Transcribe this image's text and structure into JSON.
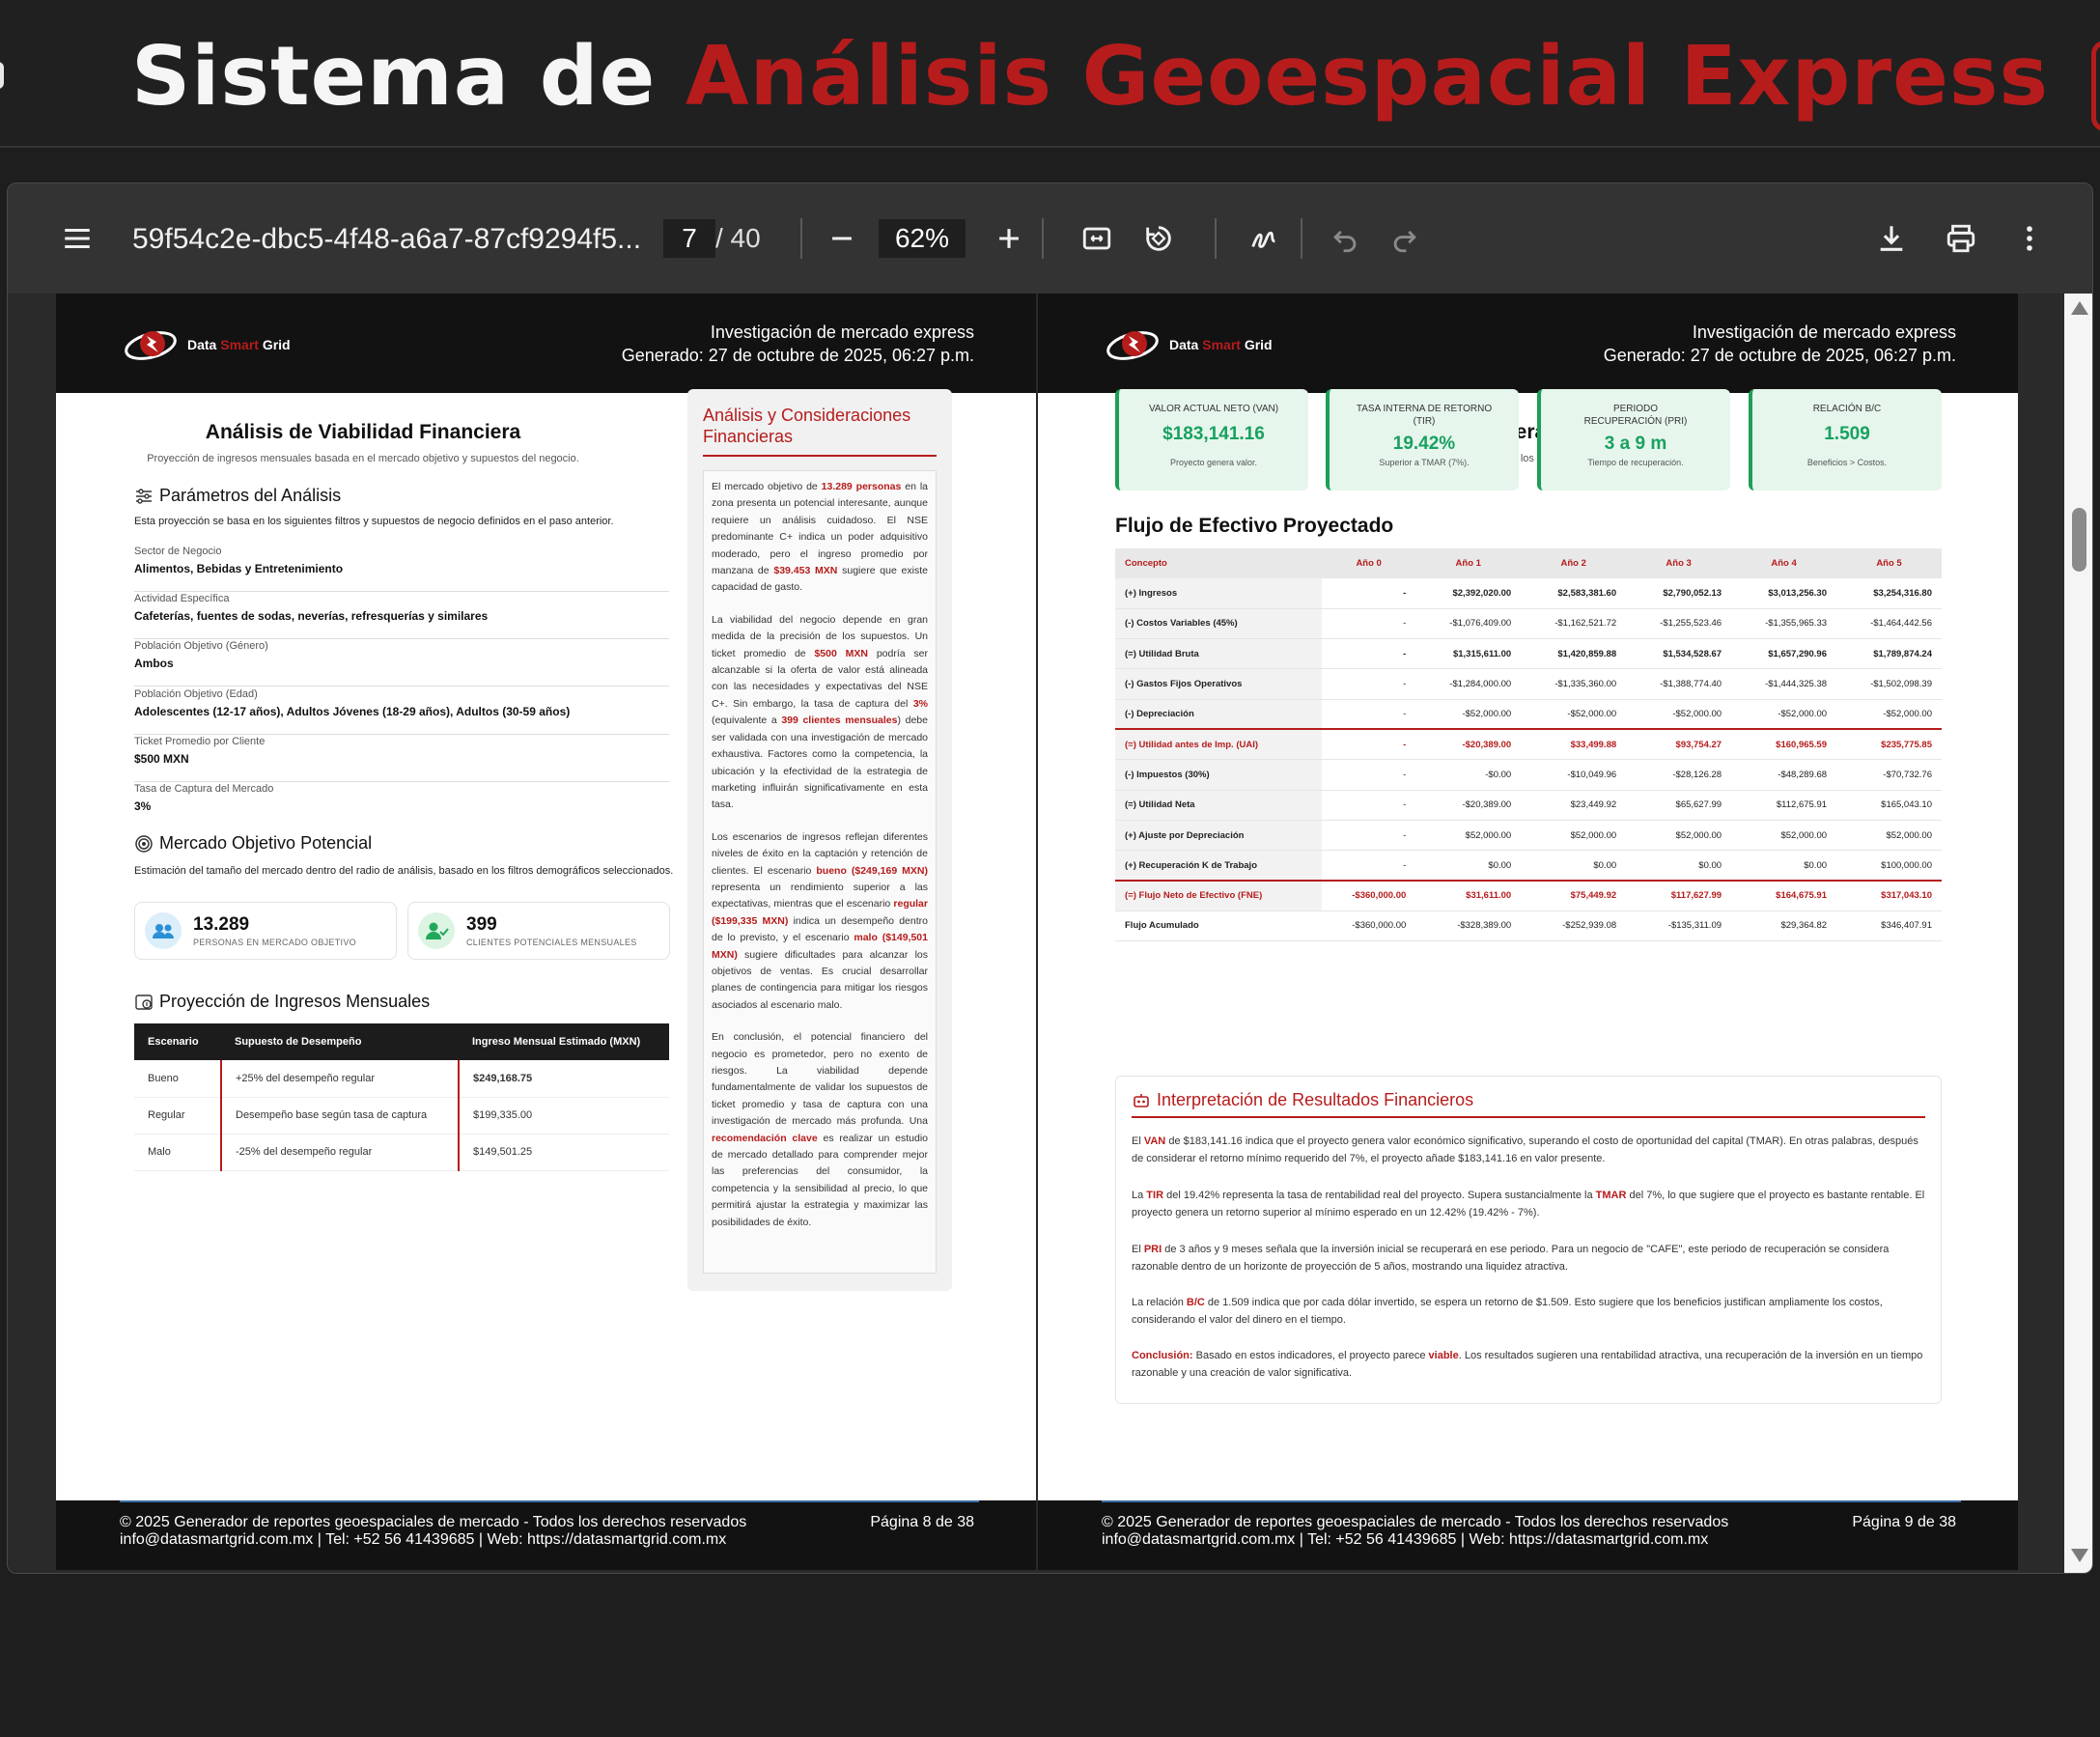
{
  "app": {
    "title_part1": "Sistema de",
    "title_part2": "Análisis Geoespacial Express"
  },
  "toolbar": {
    "doc_name": "59f54c2e-dbc5-4f48-a6a7-87cf9294f5...",
    "current_page": "7",
    "total_pages": "/ 40",
    "zoom": "62%",
    "icons": [
      "menu-icon",
      "zoom-out-icon",
      "zoom-in-icon",
      "fit-page-icon",
      "rotate-icon",
      "draw-icon",
      "undo-icon",
      "redo-icon",
      "download-icon",
      "print-icon",
      "more-icon"
    ]
  },
  "brand": {
    "part1": "Data",
    "part2": "Smart",
    "part3": "Grid",
    "accent": "#b61c1c"
  },
  "header": {
    "line1": "Investigación de mercado express",
    "line2": "Generado: 27 de octubre de 2025, 06:27 p.m."
  },
  "footer": {
    "line1": "© 2025 Generador de reportes geoespaciales de mercado - Todos los derechos reservados",
    "line2": "info@datasmartgrid.com.mx | Tel: +52 56 41439685 | Web: https://datasmartgrid.com.mx",
    "page_left": "Página 8 de 38",
    "page_right": "Página 9 de 38"
  },
  "left": {
    "title": "Análisis de Viabilidad Financiera",
    "subtitle": "Proyección de ingresos mensuales basada en el mercado objetivo y supuestos del negocio.",
    "params_title": "Parámetros del Análisis",
    "params_desc": "Esta proyección se basa en los siguientes filtros y supuestos de negocio definidos en el paso anterior.",
    "params": [
      {
        "k": "Sector de Negocio",
        "v": "Alimentos, Bebidas y Entretenimiento"
      },
      {
        "k": "Actividad Específica",
        "v": "Cafeterías, fuentes de sodas, neverías, refresquerías y similares"
      },
      {
        "k": "Población Objetivo (Género)",
        "v": "Ambos"
      },
      {
        "k": "Población Objetivo (Edad)",
        "v": "Adolescentes (12-17 años), Adultos Jóvenes (18-29 años), Adultos (30-59 años)"
      },
      {
        "k": "Ticket Promedio por Cliente",
        "v": "$500 MXN"
      },
      {
        "k": "Tasa de Captura del Mercado",
        "v": "3%"
      }
    ],
    "market_title": "Mercado Objetivo Potencial",
    "market_desc": "Estimación del tamaño del mercado dentro del radio de análisis, basado en los filtros demográficos seleccionados.",
    "stat1": {
      "num": "13.289",
      "label": "PERSONAS EN MERCADO OBJETIVO"
    },
    "stat2": {
      "num": "399",
      "label": "CLIENTES POTENCIALES MENSUALES"
    },
    "proj_title": "Proyección de Ingresos Mensuales",
    "proj_headers": [
      "Escenario",
      "Supuesto de Desempeño",
      "Ingreso Mensual Estimado (MXN)"
    ],
    "proj_rows": [
      [
        "Bueno",
        "+25% del desempeño regular",
        "$249,168.75"
      ],
      [
        "Regular",
        "Desempeño base según tasa de captura",
        "$199,335.00"
      ],
      [
        "Malo",
        "-25% del desempeño regular",
        "$149,501.25"
      ]
    ],
    "side_title": "Análisis y Consideraciones Financieras",
    "side_p1": [
      "El mercado objetivo de ",
      "13.289 personas",
      " en la zona presenta un potencial interesante, aunque requiere un análisis cuidadoso. El NSE predominante C+ indica un poder adquisitivo moderado, pero el ingreso promedio por manzana de ",
      "$39.453 MXN",
      " sugiere que existe capacidad de gasto."
    ],
    "side_p2": [
      "La viabilidad del negocio depende en gran medida de la precisión de los supuestos. Un ticket promedio de ",
      "$500 MXN",
      " podría ser alcanzable si la oferta de valor está alineada con las necesidades y expectativas del NSE C+. Sin embargo, la tasa de captura del ",
      "3%",
      " (equivalente a ",
      "399 clientes mensuales",
      ") debe ser validada con una investigación de mercado exhaustiva. Factores como la competencia, la ubicación y la efectividad de la estrategia de marketing influirán significativamente en esta tasa."
    ],
    "side_p3": [
      "Los escenarios de ingresos reflejan diferentes niveles de éxito en la captación y retención de clientes. El escenario ",
      "bueno ($249,169 MXN)",
      " representa un rendimiento superior a las expectativas, mientras que el escenario ",
      "regular ($199,335 MXN)",
      " indica un desempeño dentro de lo previsto, y el escenario ",
      "malo ($149,501 MXN)",
      " sugiere dificultades para alcanzar los objetivos de ventas. Es crucial desarrollar planes de contingencia para mitigar los riesgos asociados al escenario malo."
    ],
    "side_p4": [
      "En conclusión, el potencial financiero del negocio es prometedor, pero no exento de riesgos. La viabilidad depende fundamentalmente de validar los supuestos de ticket promedio y tasa de captura con una investigación de mercado más profunda. Una ",
      "recomendación clave",
      " es realizar un estudio de mercado detallado para comprender mejor las preferencias del consumidor, la competencia y la sensibilidad al precio, lo que permitirá ajustar la estrategia y maximizar las posibilidades de éxito."
    ]
  },
  "right": {
    "title": "Corrida Financiera Estandarizada",
    "subtitle": "Proyección basada en los supuestos ingresados.",
    "kpis": [
      {
        "t": "VALOR ACTUAL NETO (VAN)",
        "v": "$183,141.16",
        "n": "Proyecto genera valor."
      },
      {
        "t": "TASA INTERNA DE RETORNO (TIR)",
        "v": "19.42%",
        "n": "Superior a TMAR (7%)."
      },
      {
        "t": "PERIODO RECUPERACIÓN (PRI)",
        "v": "3 a 9 m",
        "n": "Tiempo de recuperación."
      },
      {
        "t": "RELACIÓN B/C",
        "v": "1.509",
        "n": "Beneficios > Costos."
      }
    ],
    "flow_title": "Flujo de Efectivo Proyectado",
    "flow_headers": [
      "Concepto",
      "Año 0",
      "Año 1",
      "Año 2",
      "Año 3",
      "Año 4",
      "Año 5"
    ],
    "flow_rows": [
      [
        "(+) Ingresos",
        "-",
        "$2,392,020.00",
        "$2,583,381.60",
        "$2,790,052.13",
        "$3,013,256.30",
        "$3,254,316.80"
      ],
      [
        "(-) Costos Variables (45%)",
        "-",
        "-$1,076,409.00",
        "-$1,162,521.72",
        "-$1,255,523.46",
        "-$1,355,965.33",
        "-$1,464,442.56"
      ],
      [
        "(=) Utilidad Bruta",
        "-",
        "$1,315,611.00",
        "$1,420,859.88",
        "$1,534,528.67",
        "$1,657,290.96",
        "$1,789,874.24"
      ],
      [
        "(-) Gastos Fijos Operativos",
        "-",
        "-$1,284,000.00",
        "-$1,335,360.00",
        "-$1,388,774.40",
        "-$1,444,325.38",
        "-$1,502,098.39"
      ],
      [
        "(-) Depreciación",
        "-",
        "-$52,000.00",
        "-$52,000.00",
        "-$52,000.00",
        "-$52,000.00",
        "-$52,000.00"
      ],
      [
        "(=) Utilidad antes de Imp. (UAI)",
        "-",
        "-$20,389.00",
        "$33,499.88",
        "$93,754.27",
        "$160,965.59",
        "$235,775.85"
      ],
      [
        "(-) Impuestos (30%)",
        "-",
        "-$0.00",
        "-$10,049.96",
        "-$28,126.28",
        "-$48,289.68",
        "-$70,732.76"
      ],
      [
        "(=) Utilidad Neta",
        "-",
        "-$20,389.00",
        "$23,449.92",
        "$65,627.99",
        "$112,675.91",
        "$165,043.10"
      ],
      [
        "(+) Ajuste por Depreciación",
        "-",
        "$52,000.00",
        "$52,000.00",
        "$52,000.00",
        "$52,000.00",
        "$52,000.00"
      ],
      [
        "(+) Recuperación K de Trabajo",
        "-",
        "$0.00",
        "$0.00",
        "$0.00",
        "$0.00",
        "$100,000.00"
      ],
      [
        "(=) Flujo Neto de Efectivo (FNE)",
        "-$360,000.00",
        "$31,611.00",
        "$75,449.92",
        "$117,627.99",
        "$164,675.91",
        "$317,043.10"
      ],
      [
        "Flujo Acumulado",
        "-$360,000.00",
        "-$328,389.00",
        "-$252,939.08",
        "-$135,311.09",
        "$29,364.82",
        "$346,407.91"
      ]
    ],
    "interp_title": "Interpretación de Resultados Financieros",
    "interp": [
      [
        "El ",
        "VAN",
        " de $183,141.16 indica que el proyecto genera valor económico significativo, superando el costo de oportunidad del capital (TMAR). En otras palabras, después de considerar el retorno mínimo requerido del 7%, el proyecto añade $183,141.16 en valor presente."
      ],
      [
        "La ",
        "TIR",
        " del 19.42% representa la tasa de rentabilidad real del proyecto. Supera sustancialmente la ",
        "TMAR",
        " del 7%, lo que sugiere que el proyecto es bastante rentable. El proyecto genera un retorno superior al mínimo esperado en un 12.42% (19.42% - 7%)."
      ],
      [
        "El ",
        "PRI",
        " de 3 años y 9 meses señala que la inversión inicial se recuperará en ese periodo. Para un negocio de \"CAFE\", este periodo de recuperación se considera razonable dentro de un horizonte de proyección de 5 años, mostrando una liquidez atractiva."
      ],
      [
        "La relación ",
        "B/C",
        " de 1.509 indica que por cada dólar invertido, se espera un retorno de $1.509. Esto sugiere que los beneficios justifican ampliamente los costos, considerando el valor del dinero en el tiempo."
      ],
      [
        "",
        "Conclusión:",
        " Basado en estos indicadores, el proyecto parece ",
        "viable",
        ". Los resultados sugieren una rentabilidad atractiva, una recuperación de la inversión en un tiempo razonable y una creación de valor significativa."
      ]
    ]
  }
}
